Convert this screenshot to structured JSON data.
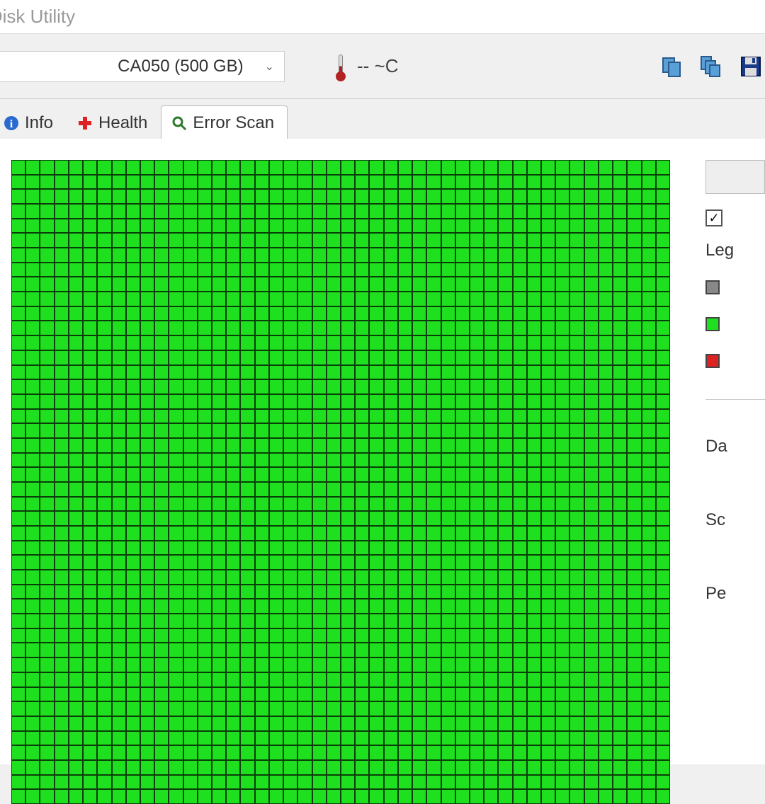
{
  "window": {
    "title": "ard Disk Utility"
  },
  "toolbar": {
    "drive": "CA050 (500 GB)",
    "temperature": "-- ~C"
  },
  "tabs": {
    "info": "Info",
    "health": "Health",
    "error_scan": "Error Scan"
  },
  "side": {
    "legend_title": "Leg",
    "stat_damaged": "Da",
    "stat_scanned": "Sc",
    "stat_percent": "Pe"
  },
  "scan": {
    "cols": 46,
    "rows": 44,
    "block_color": "good"
  }
}
